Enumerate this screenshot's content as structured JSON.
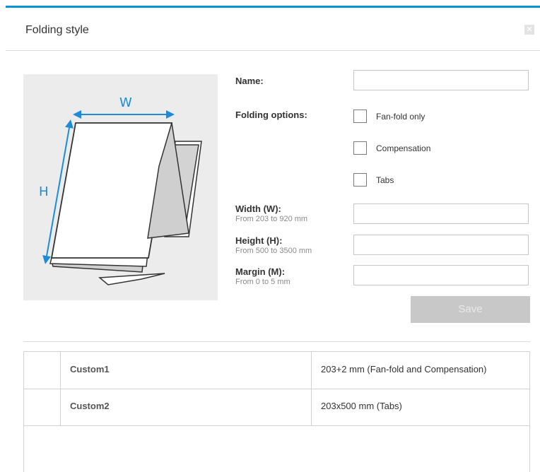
{
  "dialog": {
    "title": "Folding style",
    "close_icon": "close-icon"
  },
  "illustration": {
    "width_label": "W",
    "height_label": "H",
    "accent": "#1e8bd6"
  },
  "form": {
    "name_label": "Name:",
    "name_value": "",
    "folding_label": "Folding options:",
    "options": [
      {
        "label": "Fan-fold only",
        "checked": false
      },
      {
        "label": "Compensation",
        "checked": false
      },
      {
        "label": "Tabs",
        "checked": false
      }
    ],
    "width_label": "Width (W):",
    "width_range": "From 203 to 920 mm",
    "width_value": "",
    "height_label": "Height (H):",
    "height_range": "From 500 to 3500 mm",
    "height_value": "",
    "margin_label": "Margin (M):",
    "margin_range": "From 0 to 5 mm",
    "margin_value": "",
    "save_label": "Save"
  },
  "table": {
    "rows": [
      {
        "name": "Custom1",
        "description": "203+2 mm (Fan-fold and Compensation)"
      },
      {
        "name": "Custom2",
        "description": "203x500 mm (Tabs)"
      }
    ]
  },
  "colors": {
    "top_bar": "#0096d6",
    "save_disabled": "#c8c8c8"
  }
}
